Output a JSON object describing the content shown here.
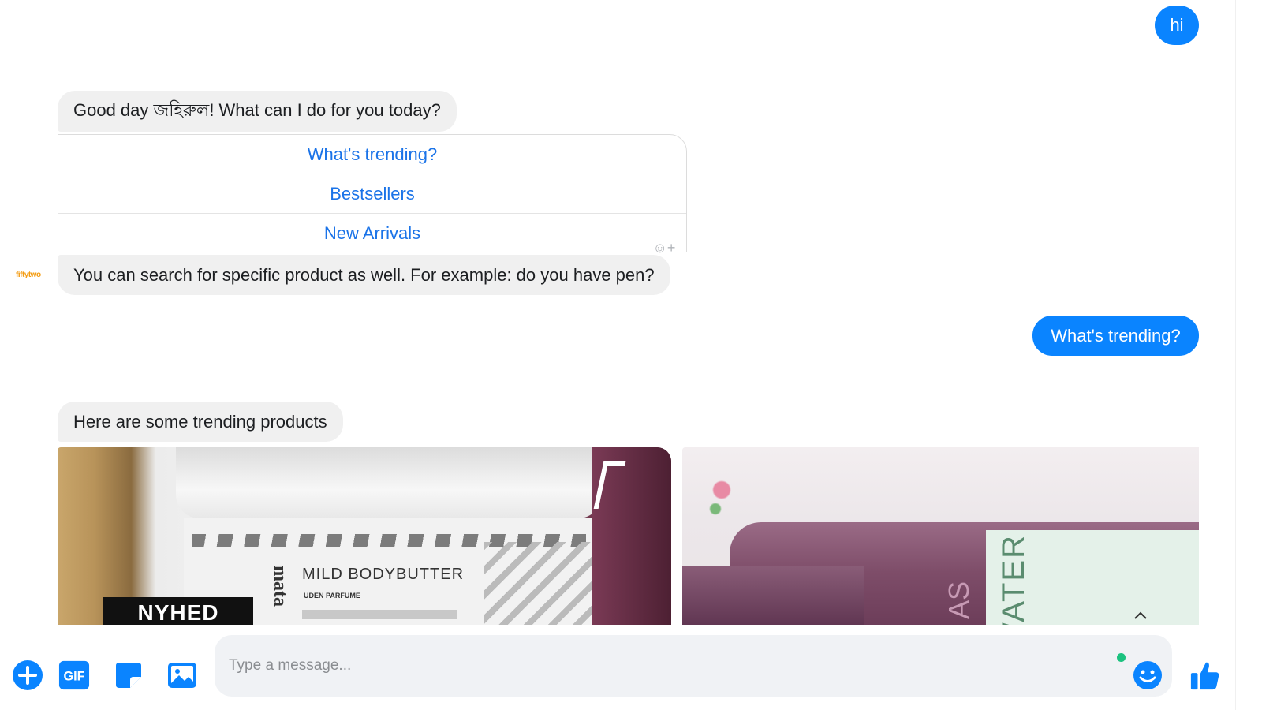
{
  "messages": {
    "out_hi": "hi",
    "greeting": "Good day জহিরুল! What can I do for you today?",
    "quick_replies": [
      "What's trending?",
      "Bestsellers",
      "New Arrivals"
    ],
    "search_hint": "You can search for specific product as well. For example: do you have pen?",
    "sender_name": "fiftytwo",
    "out_trending": "What's trending?",
    "trending_intro": "Here are some trending products"
  },
  "products": [
    {
      "image_texts": {
        "badge": "NYHED",
        "brand": "mata",
        "name": "MILD BODYBUTTER",
        "sub": "UDEN PARFUME"
      }
    },
    {
      "image_texts": {
        "label": "WATER",
        "label2": "AS"
      }
    }
  ],
  "composer": {
    "placeholder": "Type a message...",
    "icons": [
      "add-icon",
      "gif-icon",
      "sticker-icon",
      "image-icon",
      "emoji-icon",
      "thumbs-up-icon"
    ],
    "gif_label": "GIF",
    "accent": "#0a84ff"
  },
  "colors": {
    "outgoing_bubble": "#0a84ff",
    "incoming_bubble": "#f0f0f0",
    "quick_reply_text": "#1a73e8",
    "online_dot": "#1cc27f"
  }
}
